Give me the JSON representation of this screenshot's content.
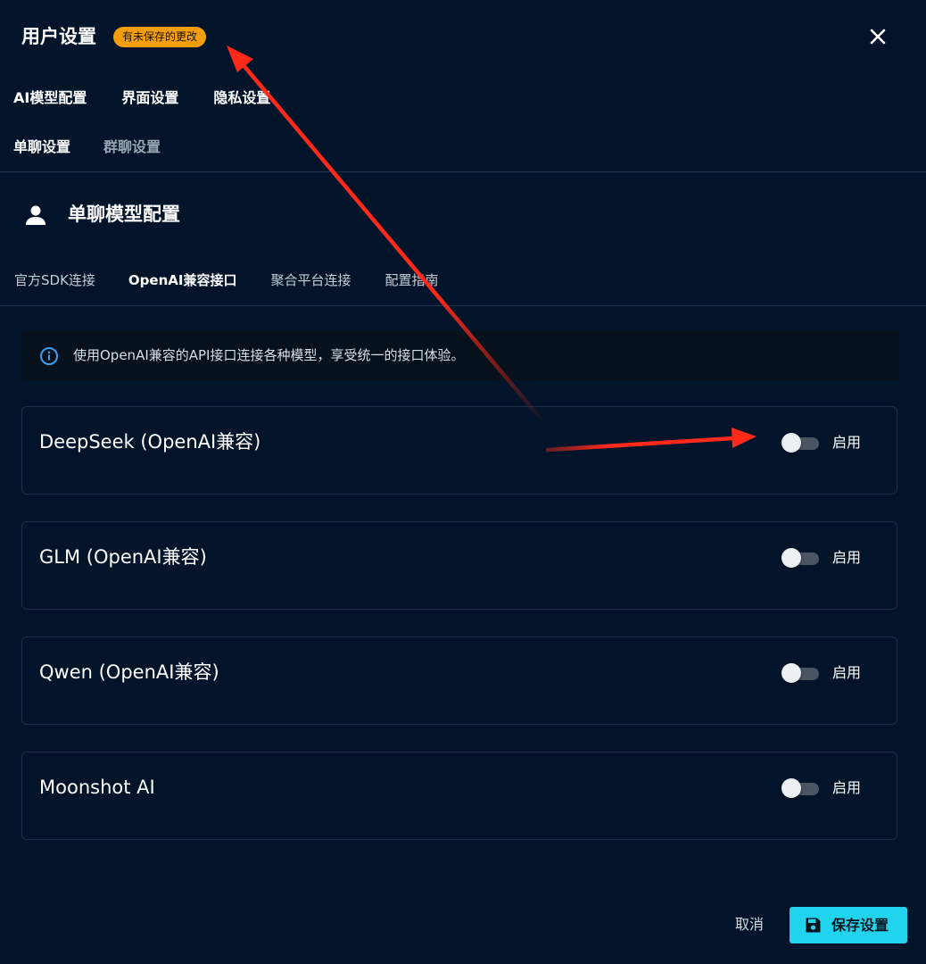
{
  "header": {
    "title": "用户设置",
    "unsaved_badge": "有未保存的更改"
  },
  "tabs_row1": [
    {
      "label": "AI模型配置"
    },
    {
      "label": "界面设置"
    },
    {
      "label": "隐私设置"
    }
  ],
  "tabs_row2": [
    {
      "label": "单聊设置",
      "active": true
    },
    {
      "label": "群聊设置",
      "active": false
    }
  ],
  "section": {
    "title": "单聊模型配置",
    "icon": "user-icon"
  },
  "subtabs": [
    {
      "label": "官方SDK连接",
      "active": false
    },
    {
      "label": "OpenAI兼容接口",
      "active": true
    },
    {
      "label": "聚合平台连接",
      "active": false
    },
    {
      "label": "配置指南",
      "active": false
    }
  ],
  "info": {
    "icon": "info-icon",
    "text": "使用OpenAI兼容的API接口连接各种模型，享受统一的接口体验。"
  },
  "providers": [
    {
      "name": "DeepSeek (OpenAI兼容)",
      "enabled": false,
      "toggle_label": "启用"
    },
    {
      "name": "GLM (OpenAI兼容)",
      "enabled": false,
      "toggle_label": "启用"
    },
    {
      "name": "Qwen (OpenAI兼容)",
      "enabled": false,
      "toggle_label": "启用"
    },
    {
      "name": "Moonshot AI",
      "enabled": false,
      "toggle_label": "启用"
    }
  ],
  "footer": {
    "cancel_label": "取消",
    "save_label": "保存设置",
    "save_icon": "floppy-disk-icon"
  },
  "colors": {
    "background": "#02142a",
    "badge": "#f59e0b",
    "primary": "#22d3ee",
    "annotation_arrow": "#ff2a1a"
  }
}
